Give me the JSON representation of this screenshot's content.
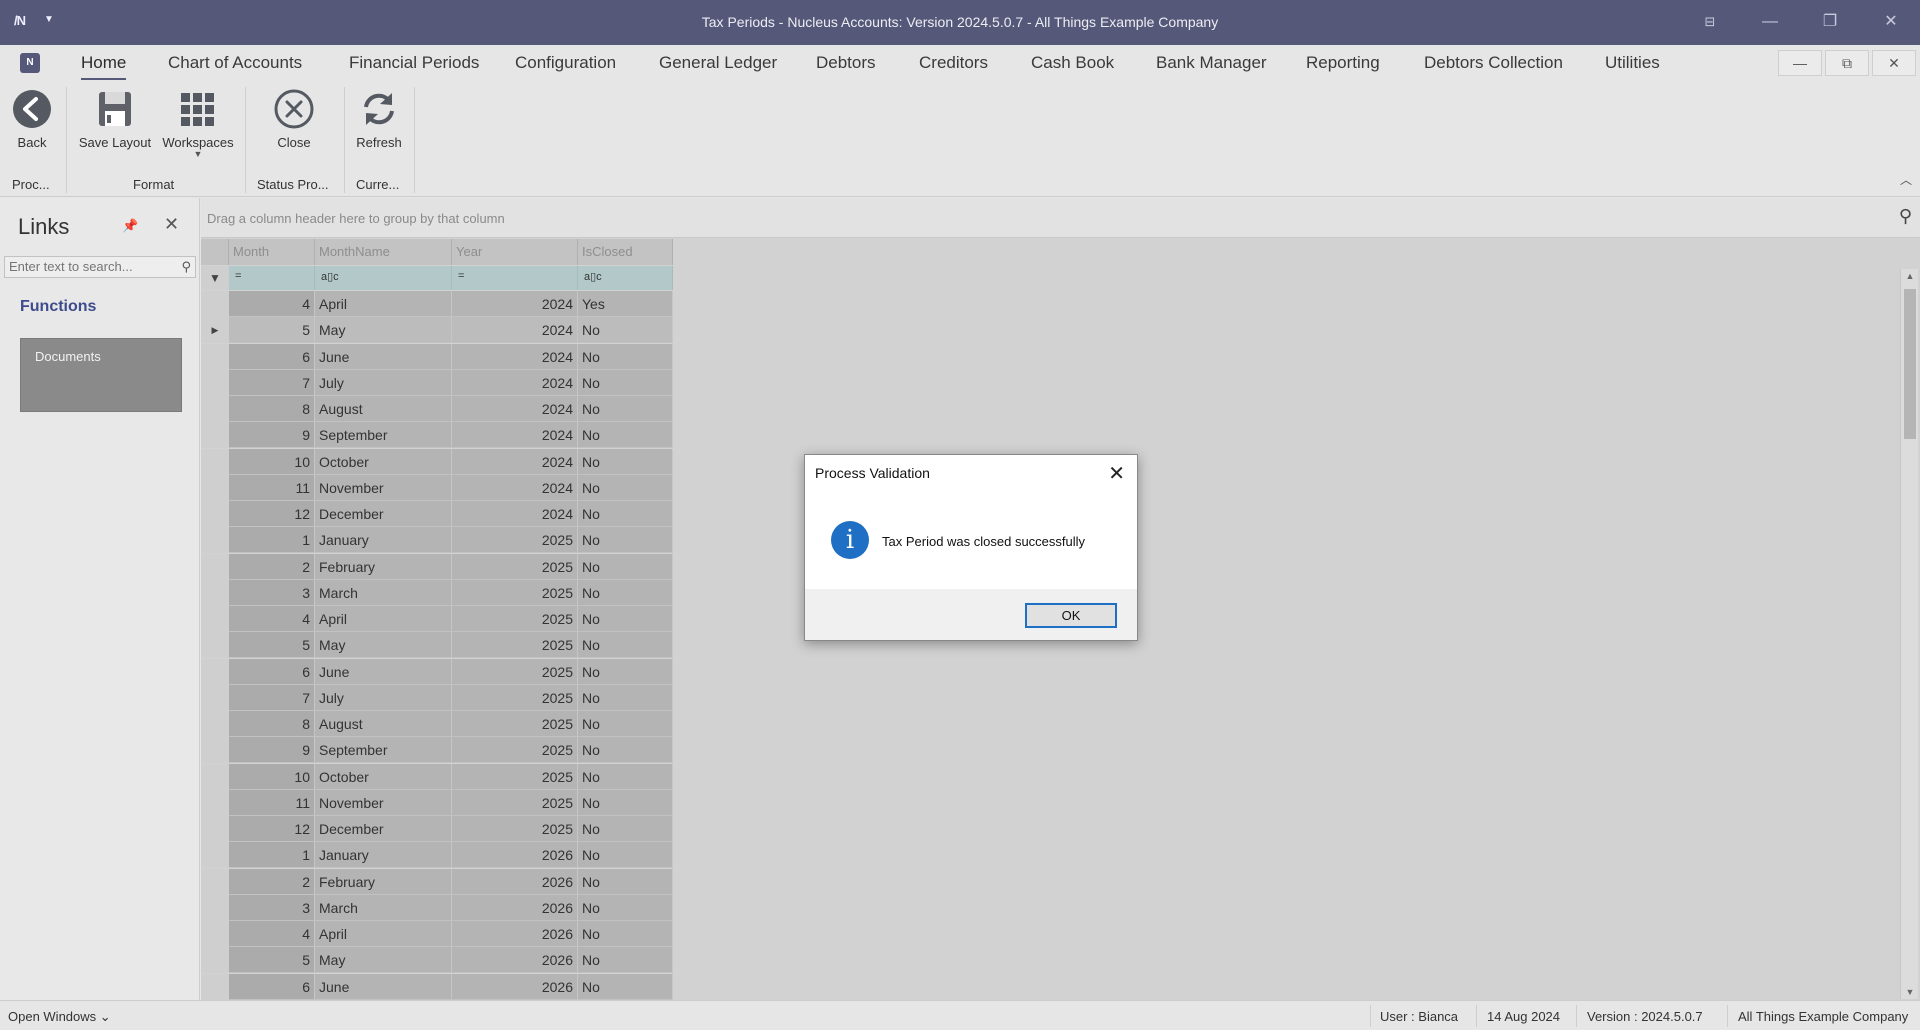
{
  "window": {
    "title": "Tax Periods - Nucleus Accounts: Version 2024.5.0.7 - All Things Example Company",
    "app_icon": "nucleus-logo-icon",
    "min_glyph": "—",
    "restore_glyph": "❐",
    "close_glyph": "✕",
    "layout_glyph": "⊟"
  },
  "menu": {
    "tabs": [
      "Home",
      "Chart of Accounts",
      "Financial Periods",
      "Configuration",
      "General Ledger",
      "Debtors",
      "Creditors",
      "Cash Book",
      "Bank Manager",
      "Reporting",
      "Debtors Collection",
      "Utilities"
    ],
    "active": "Home"
  },
  "mdi": {
    "min": "—",
    "restore": "⧉",
    "close": "✕"
  },
  "ribbon": {
    "buttons": {
      "back": "Back",
      "save_layout": "Save Layout",
      "workspaces": "Workspaces",
      "close": "Close",
      "refresh": "Refresh"
    },
    "groups": {
      "process": "Proc...",
      "format": "Format",
      "status": "Status Pro...",
      "current": "Curre..."
    }
  },
  "links": {
    "title": "Links",
    "search_placeholder": "Enter text to search...",
    "functions_heading": "Functions",
    "documents_label": "Documents"
  },
  "grid": {
    "group_hint": "Drag a column header here to group by that column",
    "columns": [
      "Month",
      "MonthName",
      "Year",
      "IsClosed"
    ],
    "filter_ops": [
      "=",
      "a▯c",
      "=",
      "a▯c"
    ],
    "rows": [
      {
        "month": "4",
        "name": "April",
        "year": "2024",
        "closed": "Yes"
      },
      {
        "month": "5",
        "name": "May",
        "year": "2024",
        "closed": "No"
      },
      {
        "month": "6",
        "name": "June",
        "year": "2024",
        "closed": "No"
      },
      {
        "month": "7",
        "name": "July",
        "year": "2024",
        "closed": "No"
      },
      {
        "month": "8",
        "name": "August",
        "year": "2024",
        "closed": "No"
      },
      {
        "month": "9",
        "name": "September",
        "year": "2024",
        "closed": "No"
      },
      {
        "month": "10",
        "name": "October",
        "year": "2024",
        "closed": "No"
      },
      {
        "month": "11",
        "name": "November",
        "year": "2024",
        "closed": "No"
      },
      {
        "month": "12",
        "name": "December",
        "year": "2024",
        "closed": "No"
      },
      {
        "month": "1",
        "name": "January",
        "year": "2025",
        "closed": "No"
      },
      {
        "month": "2",
        "name": "February",
        "year": "2025",
        "closed": "No"
      },
      {
        "month": "3",
        "name": "March",
        "year": "2025",
        "closed": "No"
      },
      {
        "month": "4",
        "name": "April",
        "year": "2025",
        "closed": "No"
      },
      {
        "month": "5",
        "name": "May",
        "year": "2025",
        "closed": "No"
      },
      {
        "month": "6",
        "name": "June",
        "year": "2025",
        "closed": "No"
      },
      {
        "month": "7",
        "name": "July",
        "year": "2025",
        "closed": "No"
      },
      {
        "month": "8",
        "name": "August",
        "year": "2025",
        "closed": "No"
      },
      {
        "month": "9",
        "name": "September",
        "year": "2025",
        "closed": "No"
      },
      {
        "month": "10",
        "name": "October",
        "year": "2025",
        "closed": "No"
      },
      {
        "month": "11",
        "name": "November",
        "year": "2025",
        "closed": "No"
      },
      {
        "month": "12",
        "name": "December",
        "year": "2025",
        "closed": "No"
      },
      {
        "month": "1",
        "name": "January",
        "year": "2026",
        "closed": "No"
      },
      {
        "month": "2",
        "name": "February",
        "year": "2026",
        "closed": "No"
      },
      {
        "month": "3",
        "name": "March",
        "year": "2026",
        "closed": "No"
      },
      {
        "month": "4",
        "name": "April",
        "year": "2026",
        "closed": "No"
      },
      {
        "month": "5",
        "name": "May",
        "year": "2026",
        "closed": "No"
      },
      {
        "month": "6",
        "name": "June",
        "year": "2026",
        "closed": "No"
      }
    ],
    "selected_row_index": 1
  },
  "status": {
    "open_windows": "Open Windows",
    "user": "User : Bianca",
    "date": "14 Aug 2024",
    "version": "Version : 2024.5.0.7",
    "company": "All Things Example Company"
  },
  "dialog": {
    "title": "Process Validation",
    "message": "Tax Period was closed successfully",
    "ok_label": "OK",
    "icon": "info-icon"
  }
}
